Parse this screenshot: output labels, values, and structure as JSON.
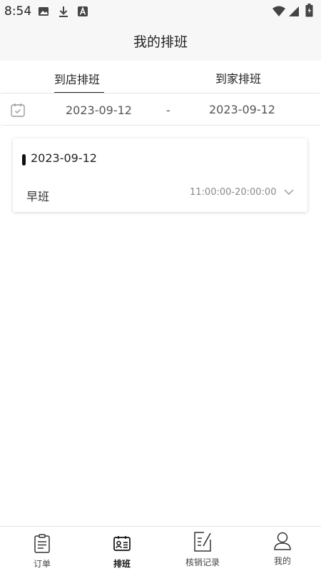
{
  "status_bar": {
    "time": "8:54",
    "icons": [
      "image-icon",
      "download-icon",
      "a-badge-icon",
      "wifi-icon",
      "signal-icon",
      "battery-icon"
    ]
  },
  "title": "我的排班",
  "tabs": [
    {
      "label": "到店排班",
      "active": true
    },
    {
      "label": "到家排班",
      "active": false
    }
  ],
  "date_range": {
    "start": "2023-09-12",
    "separator": "-",
    "end": "2023-09-12",
    "icon": "calendar-icon"
  },
  "schedule": [
    {
      "date": "2023-09-12",
      "shift_name": "早班",
      "shift_time": "11:00:00-20:00:00",
      "expand_icon": "chevron-down-icon"
    }
  ],
  "bottom_nav": [
    {
      "label": "订单",
      "icon": "clipboard-icon",
      "active": false
    },
    {
      "label": "排班",
      "icon": "id-card-icon",
      "active": true
    },
    {
      "label": "核销记录",
      "icon": "edit-list-icon",
      "active": false
    },
    {
      "label": "我的",
      "icon": "user-icon",
      "active": false
    }
  ],
  "colors": {
    "header_bg": "#f7f7f7",
    "text": "#222222",
    "muted": "#888888",
    "accent": "#111111"
  }
}
